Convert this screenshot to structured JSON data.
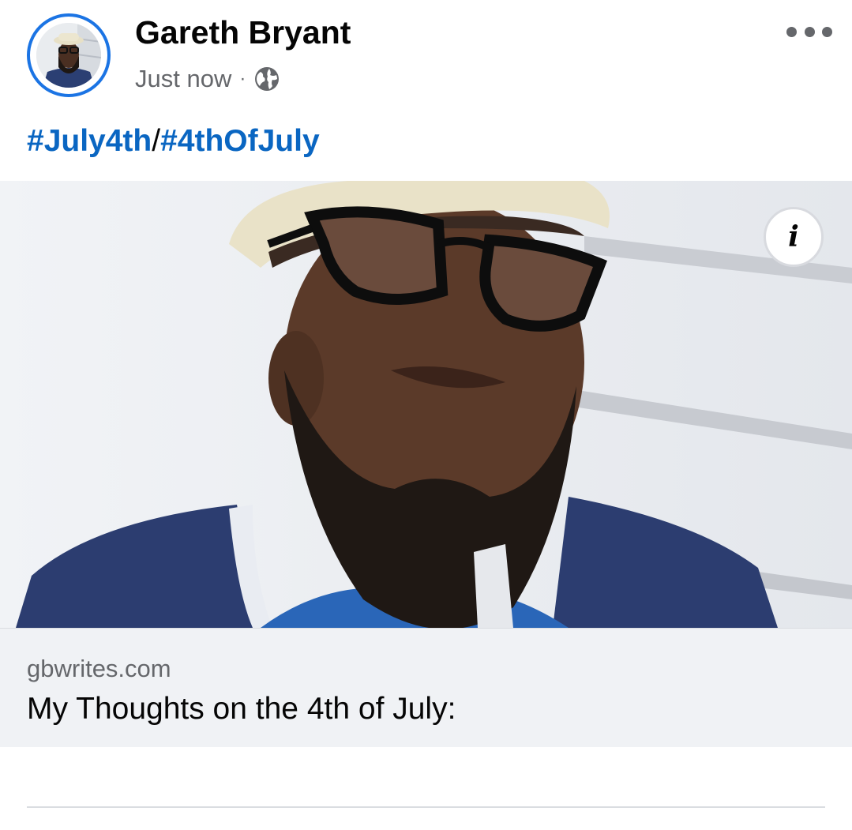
{
  "post": {
    "author": {
      "name": "Gareth Bryant"
    },
    "timestamp": "Just now",
    "separator": "·",
    "audience_icon": "globe-icon",
    "more_icon": "more-horizontal-icon",
    "hashtags": [
      "#July4th",
      "#4thOfJuly"
    ],
    "hashtag_separator": "/",
    "link_preview": {
      "domain": "gbwrites.com",
      "title": "My Thoughts on the 4th of July:",
      "info_label": "i"
    }
  },
  "colors": {
    "accent": "#1b74e4",
    "hashtag": "#0a66c2",
    "secondary_text": "#65676b",
    "primary_text": "#050505",
    "card_footer_bg": "#f0f2f5"
  }
}
